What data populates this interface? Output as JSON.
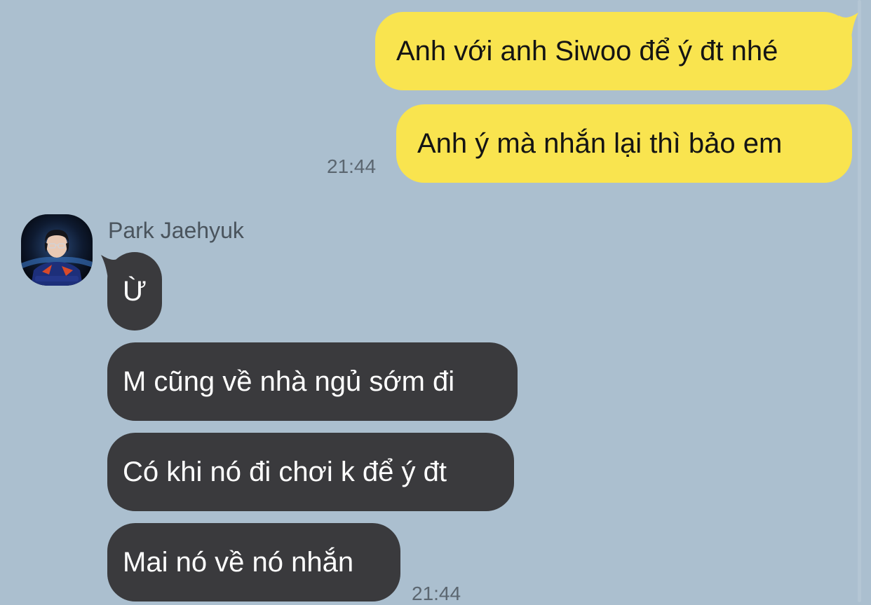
{
  "colors": {
    "background": "#abbfcf",
    "outgoing_bubble": "#f9e44f",
    "incoming_bubble": "#3a3a3d",
    "timestamp": "#5b6670"
  },
  "outgoing": {
    "messages": [
      {
        "text": "Anh với anh Siwoo để ý đt nhé"
      },
      {
        "text": "Anh ý mà nhắn lại thì bảo em"
      }
    ],
    "timestamp": "21:44"
  },
  "incoming": {
    "sender_name": "Park Jaehyuk",
    "avatar_icon": "user-avatar-photo",
    "messages": [
      {
        "text": "Ừ"
      },
      {
        "text": "M cũng về nhà ngủ sớm đi"
      },
      {
        "text": "Có khi nó đi chơi k để ý đt"
      },
      {
        "text": "Mai nó về nó nhắn"
      }
    ],
    "timestamp": "21:44"
  }
}
